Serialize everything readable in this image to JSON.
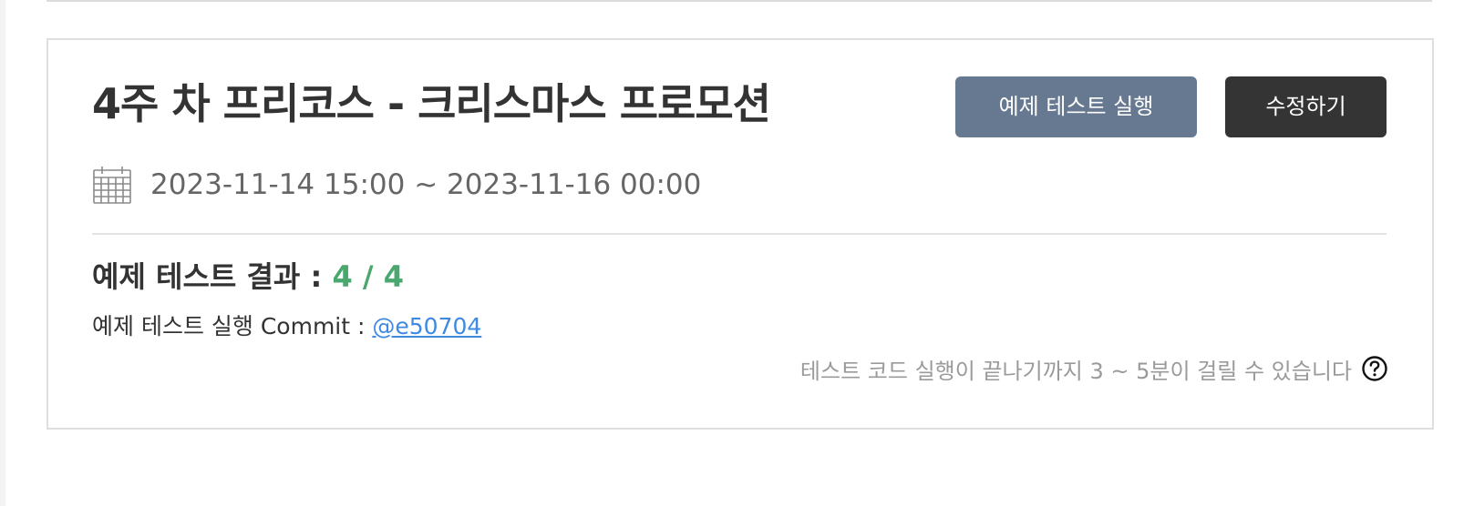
{
  "card": {
    "title": "4주 차 프리코스 - 크리스마스 프로모션",
    "buttons": {
      "run_test_label": "예제 테스트 실행",
      "edit_label": "수정하기"
    },
    "period": {
      "icon": "calendar-icon",
      "text": "2023-11-14 15:00 ~ 2023-11-16 00:00"
    },
    "result": {
      "label": "예제 테스트 결과 : ",
      "score": "4 / 4"
    },
    "commit": {
      "label": "예제 테스트 실행 Commit : ",
      "hash": "@e50704"
    },
    "notice": {
      "text": "테스트 코드 실행이 끝나기까지 3 ~ 5분이 걸릴 수 있습니다",
      "icon": "help-icon"
    }
  },
  "colors": {
    "run_button": "#677990",
    "edit_button": "#343434",
    "score": "#4aa76e",
    "link": "#3e8ae2"
  }
}
